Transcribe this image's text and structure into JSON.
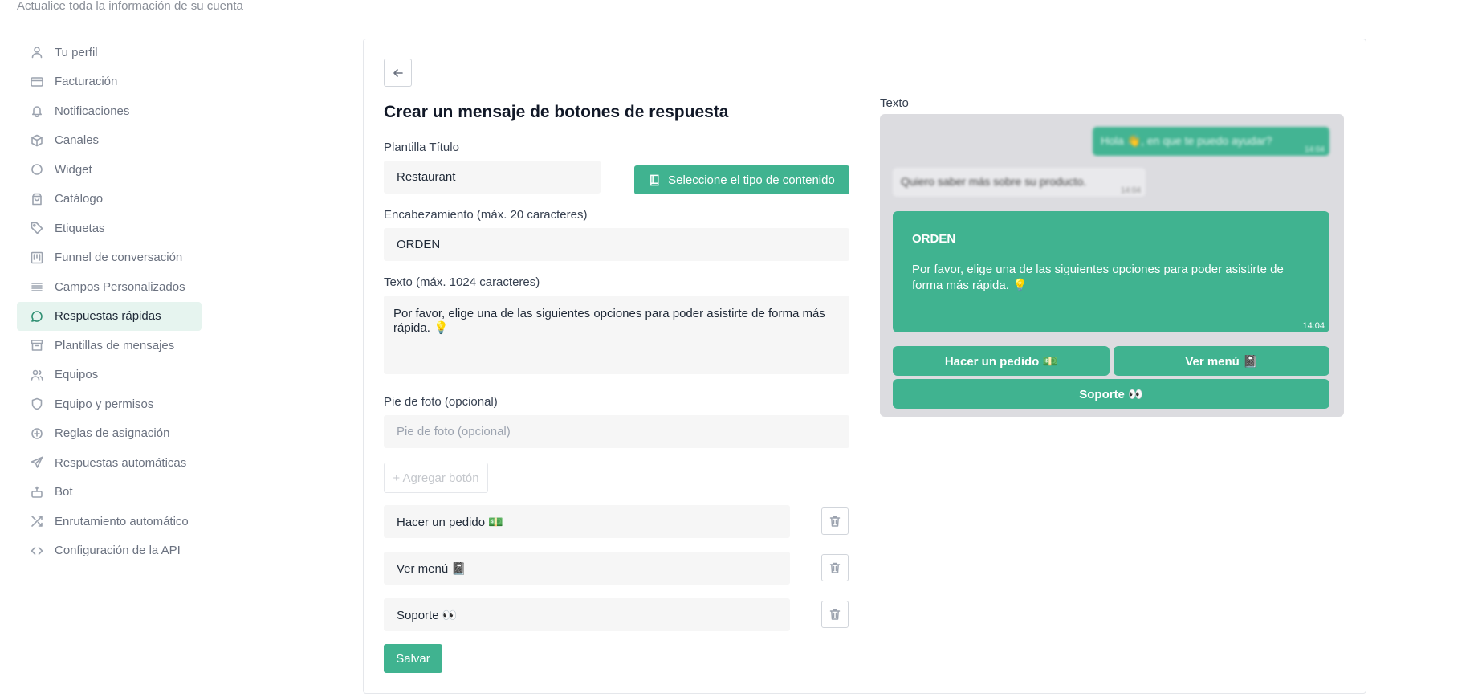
{
  "page": {
    "subtitle": "Actualice toda la información de su cuenta"
  },
  "sidebar": {
    "items": [
      {
        "label": "Tu perfil",
        "icon": "user-icon"
      },
      {
        "label": "Facturación",
        "icon": "credit-card-icon"
      },
      {
        "label": "Notificaciones",
        "icon": "bell-icon"
      },
      {
        "label": "Canales",
        "icon": "box-icon"
      },
      {
        "label": "Widget",
        "icon": "circle-icon"
      },
      {
        "label": "Catálogo",
        "icon": "shopping-bag-icon"
      },
      {
        "label": "Etiquetas",
        "icon": "tag-icon"
      },
      {
        "label": "Funnel de conversación",
        "icon": "columns-icon"
      },
      {
        "label": "Campos Personalizados",
        "icon": "list-icon"
      },
      {
        "label": "Respuestas rápidas",
        "icon": "message-circle-icon",
        "active": true
      },
      {
        "label": "Plantillas de mensajes",
        "icon": "archive-icon"
      },
      {
        "label": "Equipos",
        "icon": "users-icon"
      },
      {
        "label": "Equipo y permisos",
        "icon": "shield-icon"
      },
      {
        "label": "Reglas de asignación",
        "icon": "plus-circle-icon"
      },
      {
        "label": "Respuestas automáticas",
        "icon": "send-icon"
      },
      {
        "label": "Bot",
        "icon": "bot-icon"
      },
      {
        "label": "Enrutamiento automático",
        "icon": "shuffle-icon"
      },
      {
        "label": "Configuración de la API",
        "icon": "code-icon"
      }
    ]
  },
  "form": {
    "title": "Crear un mensaje de botones de respuesta",
    "template_title_label": "Plantilla Título",
    "template_title_value": "Restaurant",
    "content_type_button": "Seleccione el tipo de contenido",
    "header_label": "Encabezamiento (máx. 20 caracteres)",
    "header_value": "ORDEN",
    "text_label": "Texto (máx. 1024 caracteres)",
    "text_value": "Por favor, elige una de las siguientes opciones para poder asistirte de forma más rápida. 💡",
    "footer_label": "Pie de foto (opcional)",
    "footer_placeholder": "Pie de foto (opcional)",
    "add_button": "+ Agregar botón",
    "buttons": [
      {
        "value": "Hacer un pedido 💵"
      },
      {
        "value": "Ver menú 📓"
      },
      {
        "value": "Soporte 👀"
      }
    ],
    "save_button": "Salvar"
  },
  "preview": {
    "label": "Texto",
    "sample_out": {
      "text": "Hola 👋, en que te puedo ayudar?",
      "time": "14:04"
    },
    "sample_in": {
      "text": "Quiero saber más sobre su producto.",
      "time": "14:04"
    },
    "message": {
      "header": "ORDEN",
      "body": "Por favor, elige una de las siguientes opciones para poder asistirte de forma más rápida. 💡",
      "time": "14:04"
    },
    "reply_buttons": [
      "Hacer un pedido 💵",
      "Ver menú 📓",
      "Soporte 👀"
    ]
  },
  "colors": {
    "accent": "#40b390",
    "active_bg": "#e6f4ef",
    "preview_bg": "#dcdce0"
  }
}
